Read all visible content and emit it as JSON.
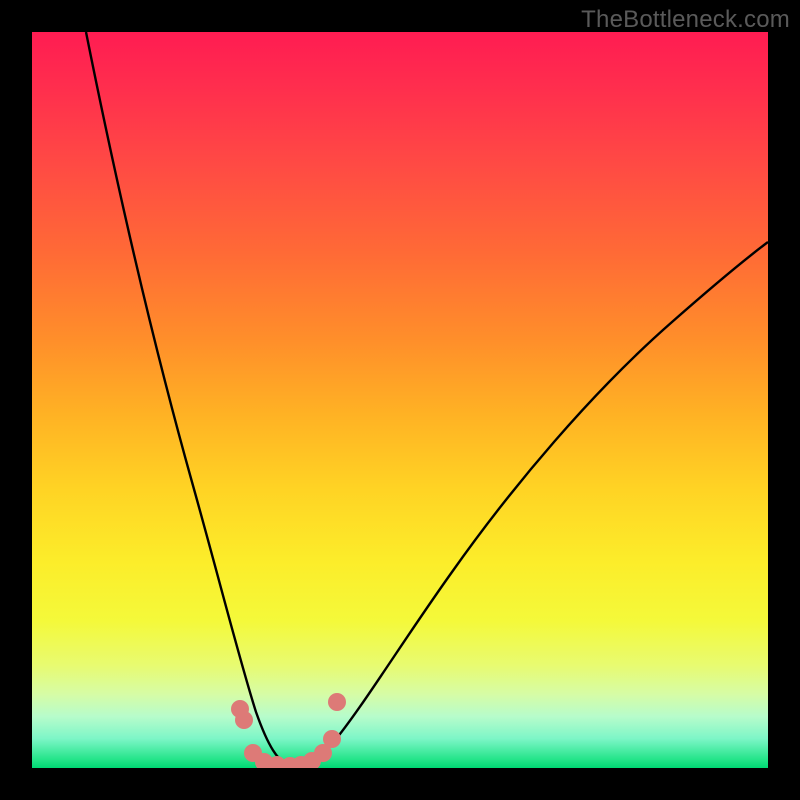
{
  "watermark": "TheBottleneck.com",
  "chart_data": {
    "type": "line",
    "title": "",
    "xlabel": "",
    "ylabel": "",
    "series": [
      {
        "name": "left-branch",
        "points": [
          {
            "x": 0.073,
            "y": 1.0
          },
          {
            "x": 0.11,
            "y": 0.81
          },
          {
            "x": 0.145,
            "y": 0.64
          },
          {
            "x": 0.175,
            "y": 0.5
          },
          {
            "x": 0.205,
            "y": 0.37
          },
          {
            "x": 0.232,
            "y": 0.255
          },
          {
            "x": 0.255,
            "y": 0.165
          },
          {
            "x": 0.272,
            "y": 0.1
          },
          {
            "x": 0.286,
            "y": 0.052
          },
          {
            "x": 0.3,
            "y": 0.022
          },
          {
            "x": 0.32,
            "y": 0.006
          },
          {
            "x": 0.345,
            "y": 0.0
          }
        ]
      },
      {
        "name": "right-branch",
        "points": [
          {
            "x": 0.345,
            "y": 0.0
          },
          {
            "x": 0.37,
            "y": 0.004
          },
          {
            "x": 0.395,
            "y": 0.02
          },
          {
            "x": 0.42,
            "y": 0.05
          },
          {
            "x": 0.455,
            "y": 0.105
          },
          {
            "x": 0.5,
            "y": 0.18
          },
          {
            "x": 0.555,
            "y": 0.265
          },
          {
            "x": 0.62,
            "y": 0.355
          },
          {
            "x": 0.69,
            "y": 0.44
          },
          {
            "x": 0.77,
            "y": 0.525
          },
          {
            "x": 0.855,
            "y": 0.605
          },
          {
            "x": 0.935,
            "y": 0.67
          },
          {
            "x": 1.0,
            "y": 0.72
          }
        ]
      }
    ],
    "markers": [
      {
        "x": 0.283,
        "y": 0.08
      },
      {
        "x": 0.288,
        "y": 0.065
      },
      {
        "x": 0.3,
        "y": 0.02
      },
      {
        "x": 0.315,
        "y": 0.008
      },
      {
        "x": 0.333,
        "y": 0.003
      },
      {
        "x": 0.35,
        "y": 0.002
      },
      {
        "x": 0.365,
        "y": 0.004
      },
      {
        "x": 0.38,
        "y": 0.01
      },
      {
        "x": 0.395,
        "y": 0.02
      },
      {
        "x": 0.408,
        "y": 0.04
      },
      {
        "x": 0.415,
        "y": 0.09
      }
    ],
    "xlim": [
      0,
      1
    ],
    "ylim": [
      0,
      1
    ]
  }
}
